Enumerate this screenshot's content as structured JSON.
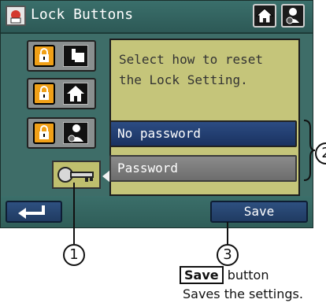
{
  "window": {
    "title": "Lock Buttons"
  },
  "main": {
    "message_line1": "Select how to reset",
    "message_line2": "the Lock Setting.",
    "options": [
      {
        "label": "No password",
        "selected": true
      },
      {
        "label": "Password",
        "selected": false
      }
    ]
  },
  "bottom": {
    "save_label": "Save"
  },
  "annotations": {
    "callout_1": "1",
    "callout_2": "2",
    "callout_3": "3",
    "caption_bold": "Save",
    "caption_rest": "button",
    "caption_line2": "Saves the settings."
  },
  "icons": [
    "lock-settings-icon",
    "home-icon",
    "user-settings-icon",
    "lock-icon",
    "touch-hand-icon",
    "key-icon",
    "back-arrow-icon"
  ],
  "colors": {
    "accent": "#2c4c83",
    "panel_bg": "#c5c57a",
    "screen_bg": "#3e6d68",
    "lock_orange": "#f0a017"
  }
}
